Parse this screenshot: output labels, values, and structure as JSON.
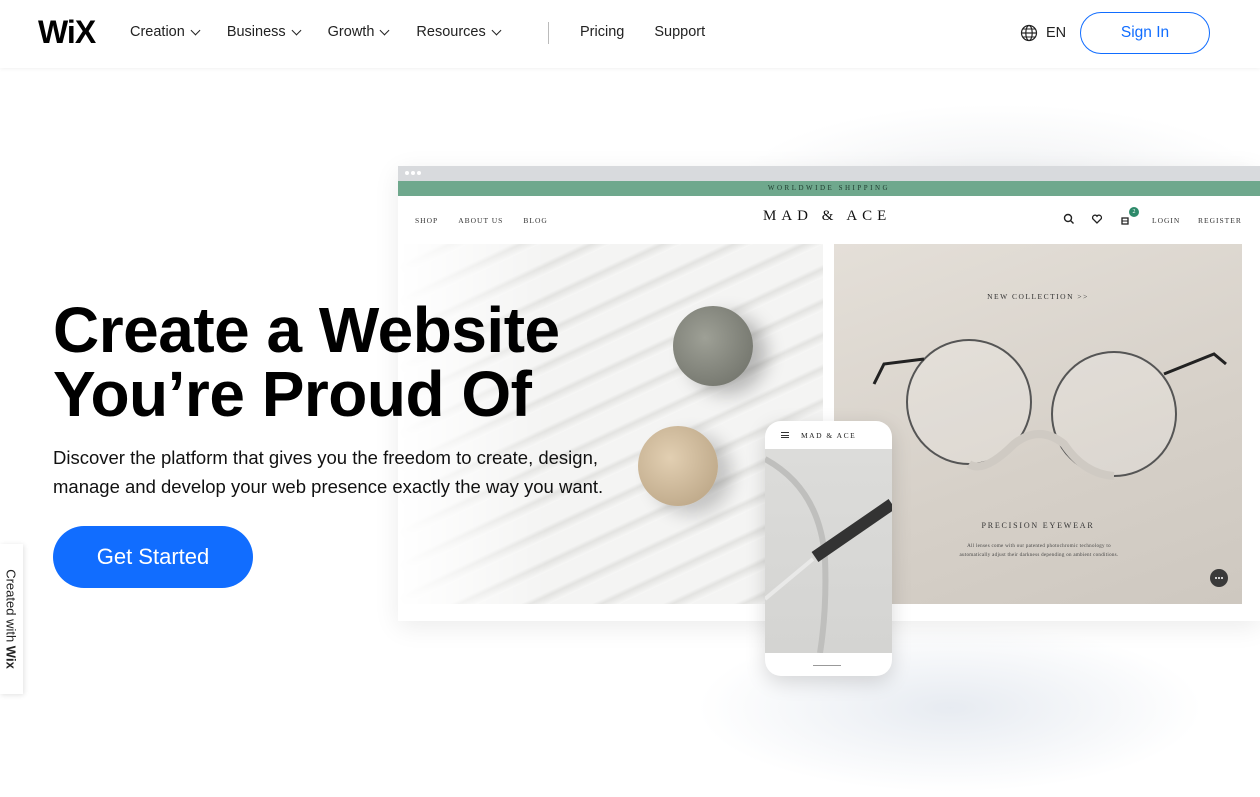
{
  "header": {
    "logo": "WiX",
    "nav_items": [
      {
        "label": "Creation",
        "has_dropdown": true
      },
      {
        "label": "Business",
        "has_dropdown": true
      },
      {
        "label": "Growth",
        "has_dropdown": true
      },
      {
        "label": "Resources",
        "has_dropdown": true
      }
    ],
    "nav_links": [
      {
        "label": "Pricing"
      },
      {
        "label": "Support"
      }
    ],
    "language": {
      "icon": "globe-icon",
      "label": "EN"
    },
    "signin_label": "Sign In"
  },
  "hero": {
    "title_line1": "Create a Website",
    "title_line2": "You’re Proud Of",
    "subtitle_line1": "Discover the platform that gives you the freedom to create, design,",
    "subtitle_line2": "manage and develop your web presence exactly the way you want.",
    "cta_label": "Get Started"
  },
  "mockup": {
    "shipping_banner": "WORLDWIDE SHIPPING",
    "nav_left": [
      "SHOP",
      "ABOUT US",
      "BLOG"
    ],
    "brand": "MAD & ACE",
    "icons": [
      "search-icon",
      "heart-icon",
      "cart-icon"
    ],
    "cart_count": "2",
    "login": "LOGIN",
    "register": "REGISTER",
    "new_collection": "NEW COLLECTION   >>",
    "product_title": "PRECISION EYEWEAR",
    "product_desc_line1": "All lenses come with our patented photochromic technology to",
    "product_desc_line2": "automatically adjust their darkness depending on ambient conditions."
  },
  "phone": {
    "brand": "MAD & ACE"
  },
  "created_with": {
    "prefix": "Created with ",
    "brand": "Wix"
  },
  "colors": {
    "accent": "#116dff",
    "shipping_banner": "#6fa88d"
  }
}
